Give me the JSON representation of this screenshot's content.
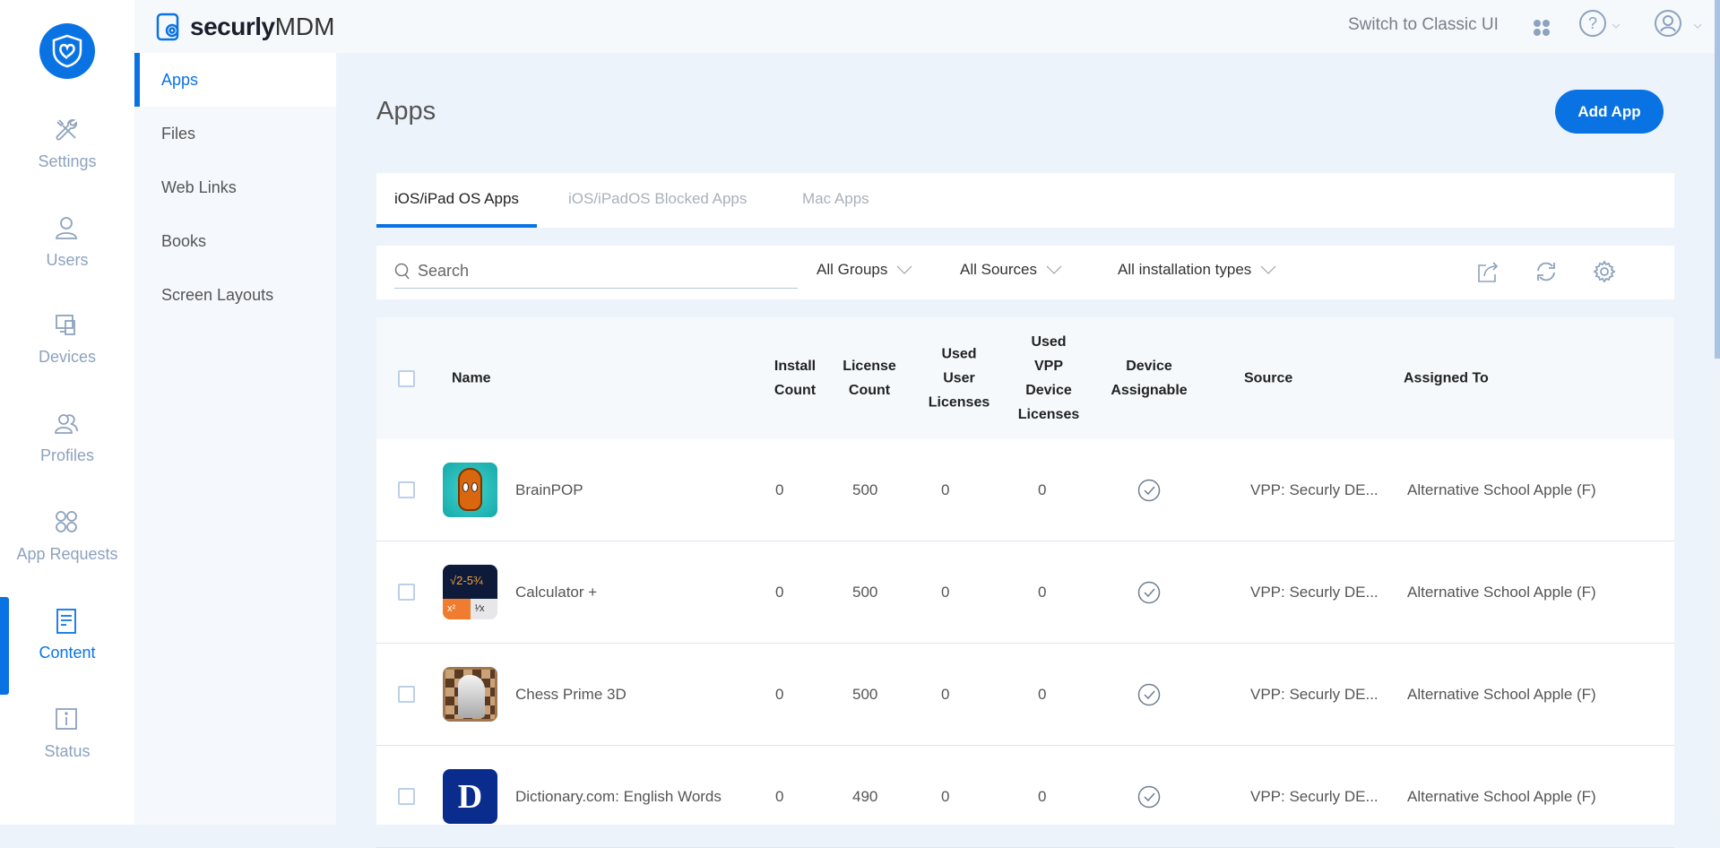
{
  "brand": {
    "name_bold": "securly",
    "name_light": "MDM"
  },
  "topbar": {
    "switch_label": "Switch to Classic UI",
    "icons": [
      "apps-grid-icon",
      "help-icon",
      "user-icon"
    ]
  },
  "rail": [
    {
      "label": "Settings",
      "icon": "tools-icon"
    },
    {
      "label": "Users",
      "icon": "user-icon"
    },
    {
      "label": "Devices",
      "icon": "devices-icon"
    },
    {
      "label": "Profiles",
      "icon": "profiles-icon"
    },
    {
      "label": "App Requests",
      "icon": "app-requests-icon"
    },
    {
      "label": "Content",
      "icon": "content-icon",
      "active": true
    },
    {
      "label": "Status",
      "icon": "info-icon"
    }
  ],
  "subnav": [
    {
      "label": "Apps",
      "active": true
    },
    {
      "label": "Files"
    },
    {
      "label": "Web Links"
    },
    {
      "label": "Books"
    },
    {
      "label": "Screen Layouts"
    }
  ],
  "page": {
    "title": "Apps",
    "add_button": "Add App"
  },
  "tabs": [
    {
      "label": "iOS/iPad OS Apps",
      "active": true
    },
    {
      "label": "iOS/iPadOS Blocked Apps"
    },
    {
      "label": "Mac Apps"
    }
  ],
  "filters": {
    "search_placeholder": "Search",
    "groups": "All Groups",
    "sources": "All Sources",
    "install_types": "All installation types"
  },
  "columns": [
    "Name",
    "Install\nCount",
    "License\nCount",
    "Used\nUser\nLicenses",
    "Used\nVPP\nDevice\nLicenses",
    "Device\nAssignable",
    "Source",
    "Assigned To"
  ],
  "rows": [
    {
      "name": "BrainPOP",
      "icon": "brainpop",
      "install": "0",
      "license": "500",
      "used_user": "0",
      "used_vpp": "0",
      "device_assignable": true,
      "source": "VPP: Securly DE...",
      "assigned": "Alternative School Apple (F)"
    },
    {
      "name": "Calculator +",
      "icon": "calculator",
      "install": "0",
      "license": "500",
      "used_user": "0",
      "used_vpp": "0",
      "device_assignable": true,
      "source": "VPP: Securly DE...",
      "assigned": "Alternative School Apple (F)"
    },
    {
      "name": "Chess Prime 3D",
      "icon": "chess",
      "install": "0",
      "license": "500",
      "used_user": "0",
      "used_vpp": "0",
      "device_assignable": true,
      "source": "VPP: Securly DE...",
      "assigned": "Alternative School Apple (F)"
    },
    {
      "name": "Dictionary.com: English Words",
      "icon": "dictionary",
      "install": "0",
      "license": "490",
      "used_user": "0",
      "used_vpp": "0",
      "device_assignable": true,
      "source": "VPP: Securly DE...",
      "assigned": "Alternative School Apple (F)"
    }
  ],
  "colors": {
    "accent": "#0a73e3",
    "main_bg": "#ecf3fb"
  }
}
